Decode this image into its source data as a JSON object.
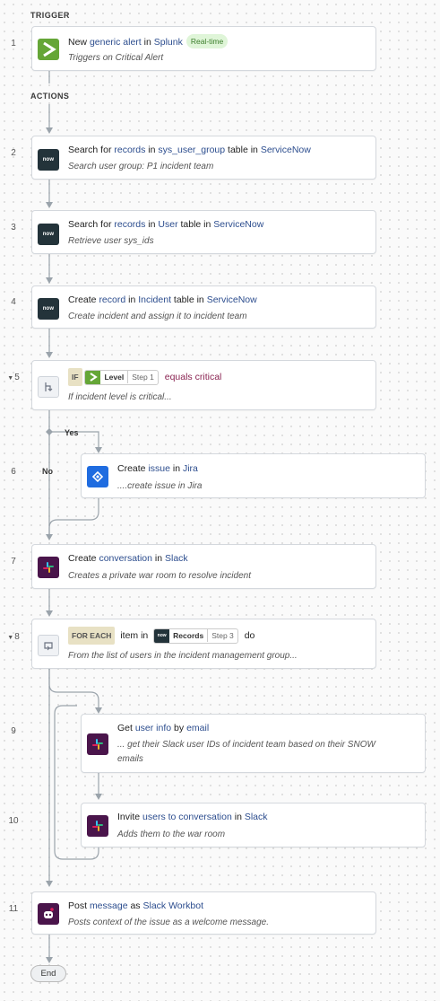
{
  "sections": {
    "trigger": "TRIGGER",
    "actions": "ACTIONS"
  },
  "steps": {
    "s1": {
      "num": "1",
      "l1": {
        "a": "New ",
        "b": "generic alert",
        "c": " in ",
        "d": "Splunk"
      },
      "badge": "Real-time",
      "desc": "Triggers on Critical Alert",
      "icon": "splunk-icon"
    },
    "s2": {
      "num": "2",
      "l1": {
        "a": "Search for ",
        "b": "records",
        "c": " in ",
        "d": "sys_user_group",
        "e": " table in ",
        "f": "ServiceNow"
      },
      "desc": "Search user group: P1 incident team",
      "icon_text": "now"
    },
    "s3": {
      "num": "3",
      "l1": {
        "a": "Search for ",
        "b": "records",
        "c": " in ",
        "d": "User",
        "e": " table in ",
        "f": "ServiceNow"
      },
      "desc": "Retrieve user sys_ids",
      "icon_text": "now"
    },
    "s4": {
      "num": "4",
      "l1": {
        "a": "Create ",
        "b": "record",
        "c": " in ",
        "d": "Incident",
        "e": " table in ",
        "f": "ServiceNow"
      },
      "desc": "Create incident and assign it to incident team",
      "icon_text": "now"
    },
    "s5": {
      "num": "5",
      "if_tag": "IF",
      "chip_name": "Level",
      "chip_step": "Step 1",
      "op": "equals",
      "value": "critical",
      "desc": "If incident level is critical...",
      "icon": "branch-icon"
    },
    "s6": {
      "num": "6",
      "l1": {
        "a": "Create ",
        "b": "issue",
        "c": " in ",
        "d": "Jira"
      },
      "desc": "....create issue in Jira",
      "icon": "jira-icon"
    },
    "s7": {
      "num": "7",
      "l1": {
        "a": "Create ",
        "b": "conversation",
        "c": " in ",
        "d": "Slack"
      },
      "desc": "Creates a private war room to resolve incident",
      "icon": "slack-icon"
    },
    "s8": {
      "num": "8",
      "foreach_tag": "FOR EACH",
      "mid": "item in",
      "chip_icon_text": "now",
      "chip_name": "Records",
      "chip_step": "Step 3",
      "end": "do",
      "desc": "From the list of users in the incident management group...",
      "icon": "loop-icon"
    },
    "s9": {
      "num": "9",
      "l1": {
        "a": "Get ",
        "b": "user info",
        "c": " by ",
        "d": "email"
      },
      "desc1": "... get their Slack user IDs of incident team based on their SNOW",
      "desc2": "emails",
      "icon": "slack-icon"
    },
    "s10": {
      "num": "10",
      "l1": {
        "a": "Invite ",
        "b": "users to conversation",
        "c": " in ",
        "d": "Slack"
      },
      "desc": "Adds them to the war room",
      "icon": "slack-icon"
    },
    "s11": {
      "num": "11",
      "l1": {
        "a": "Post ",
        "b": "message",
        "c": " as ",
        "d": "Slack Workbot"
      },
      "desc": "Posts context of the issue as a welcome message.",
      "icon": "workbot-icon"
    }
  },
  "branches": {
    "yes": "Yes",
    "no": "No"
  },
  "end_label": "End",
  "colors": {
    "link": "#2c4d8e",
    "value_red": "#8a2452",
    "splunk": "#65a637",
    "servicenow": "#23333a",
    "slack": "#4a154b",
    "jira": "#1f6ce0"
  }
}
